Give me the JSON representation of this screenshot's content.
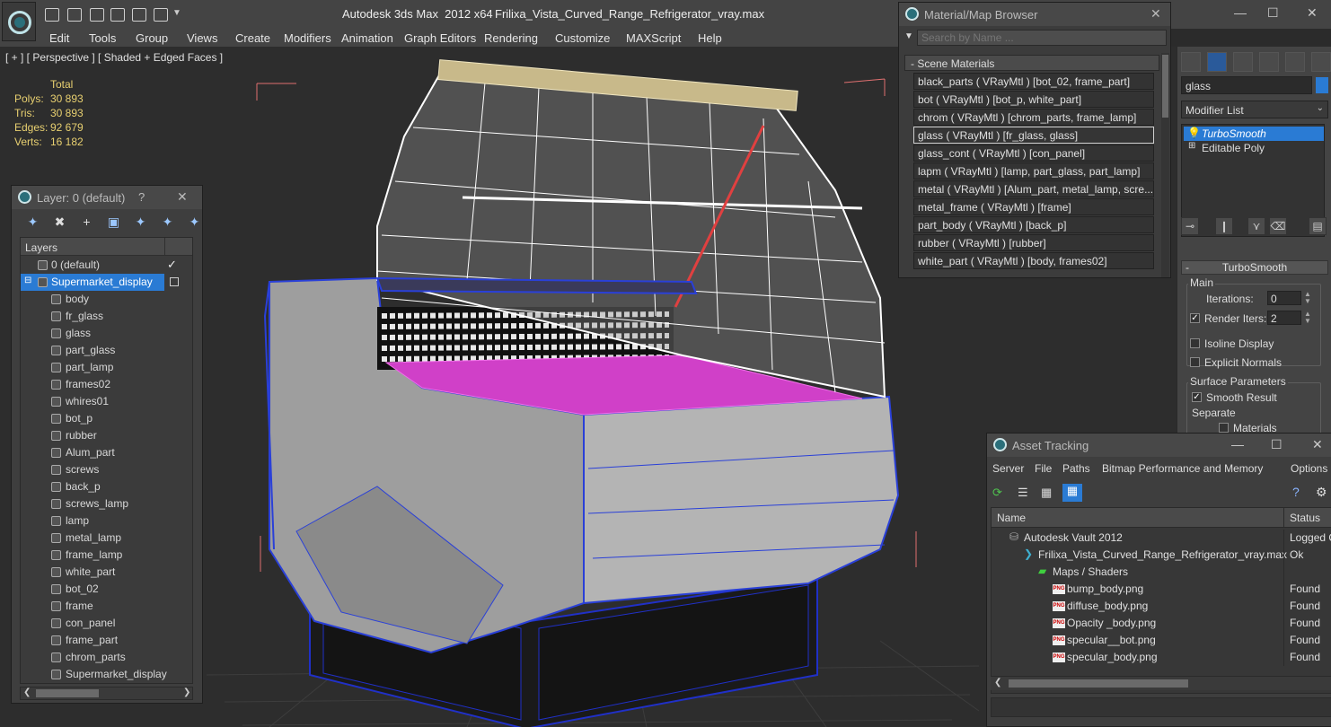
{
  "window": {
    "app_title": "Autodesk 3ds Max  2012 x64",
    "file_title": "Frilixa_Vista_Curved_Range_Refrigerator_vray.max"
  },
  "menu": [
    "Edit",
    "Tools",
    "Group",
    "Views",
    "Create",
    "Modifiers",
    "Animation",
    "Graph Editors",
    "Rendering",
    "Customize",
    "MAXScript",
    "Help"
  ],
  "viewport": {
    "label": "[ + ] [ Perspective ] [ Shaded + Edged Faces ]",
    "stats": {
      "header": "Total",
      "rows": [
        {
          "label": "Polys:",
          "value": "30 893"
        },
        {
          "label": "Tris:",
          "value": "30 893"
        },
        {
          "label": "Edges:",
          "value": "92 679"
        },
        {
          "label": "Verts:",
          "value": "16 182"
        }
      ]
    }
  },
  "layer_manager": {
    "title": "Layer: 0 (default)",
    "help": "?",
    "close": "✕",
    "column_header": "Layers",
    "default_layer": "0 (default)",
    "selected_layer": "Supermarket_display",
    "objects": [
      "body",
      "fr_glass",
      "glass",
      "part_glass",
      "part_lamp",
      "frames02",
      "whires01",
      "bot_p",
      "rubber",
      "Alum_part",
      "screws",
      "back_p",
      "screws_lamp",
      "lamp",
      "metal_lamp",
      "frame_lamp",
      "white_part",
      "bot_02",
      "frame",
      "con_panel",
      "frame_part",
      "chrom_parts",
      "Supermarket_display"
    ]
  },
  "material_browser": {
    "title": "Material/Map Browser",
    "search_placeholder": "Search by Name ...",
    "section": "- Scene Materials",
    "materials": [
      "black_parts  ( VRayMtl )  [bot_02, frame_part]",
      "bot  ( VRayMtl )  [bot_p, white_part]",
      "chrom  ( VRayMtl )  [chrom_parts, frame_lamp]",
      "glass  ( VRayMtl )  [fr_glass, glass]",
      "glass_cont  ( VRayMtl )  [con_panel]",
      "lapm  ( VRayMtl )  [lamp, part_glass, part_lamp]",
      "metal  ( VRayMtl )  [Alum_part, metal_lamp, scre...",
      "metal_frame  ( VRayMtl )  [frame]",
      "part_body  ( VRayMtl )  [back_p]",
      "rubber  ( VRayMtl )  [rubber]",
      "white_part  ( VRayMtl )  [body, frames02]"
    ],
    "selected_index": 3
  },
  "command_panel": {
    "object_name": "glass",
    "object_color": "#2a7bd4",
    "modifier_list": "Modifier List",
    "stack": [
      {
        "label": "TurboSmooth",
        "selected": true
      },
      {
        "label": "Editable Poly",
        "selected": false
      }
    ],
    "turbosmooth": {
      "header": "TurboSmooth",
      "main_group": "Main",
      "iterations_label": "Iterations:",
      "iterations_value": "0",
      "render_iters_label": "Render Iters:",
      "render_iters_value": "2",
      "render_iters_checked": true,
      "isoline_label": "Isoline Display",
      "explicit_label": "Explicit Normals",
      "surface_group": "Surface Parameters",
      "smooth_result_label": "Smooth Result",
      "separate_label": "Separate",
      "materials_label": "Materials"
    }
  },
  "asset_tracking": {
    "title": "Asset Tracking",
    "menu": [
      "Server",
      "File",
      "Paths",
      "Bitmap Performance and Memory",
      "Options"
    ],
    "columns": {
      "name": "Name",
      "status": "Status"
    },
    "rows": [
      {
        "name": "Autodesk Vault 2012",
        "status": "Logged O",
        "indent": 0,
        "icon": "vault"
      },
      {
        "name": "Frilixa_Vista_Curved_Range_Refrigerator_vray.max",
        "status": "Ok",
        "indent": 1,
        "icon": "max"
      },
      {
        "name": "Maps / Shaders",
        "status": "",
        "indent": 2,
        "icon": "maps"
      },
      {
        "name": "bump_body.png",
        "status": "Found",
        "indent": 3,
        "icon": "png"
      },
      {
        "name": "diffuse_body.png",
        "status": "Found",
        "indent": 3,
        "icon": "png"
      },
      {
        "name": "Opacity _body.png",
        "status": "Found",
        "indent": 3,
        "icon": "png"
      },
      {
        "name": "specular__bot.png",
        "status": "Found",
        "indent": 3,
        "icon": "png"
      },
      {
        "name": "specular_body.png",
        "status": "Found",
        "indent": 3,
        "icon": "png"
      }
    ]
  },
  "colors": {
    "selection_blue": "#2a7bd4",
    "stats_yellow": "#e8d070",
    "floor_magenta": "#d040c8"
  }
}
